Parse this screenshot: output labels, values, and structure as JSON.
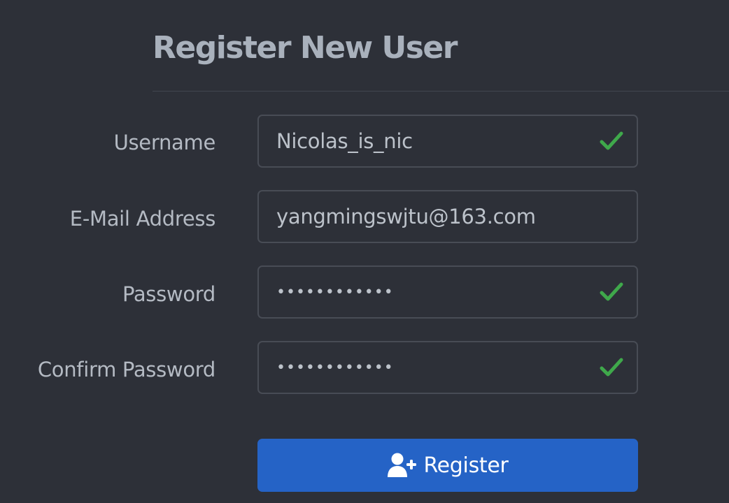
{
  "page": {
    "title": "Register New User"
  },
  "form": {
    "username": {
      "label": "Username",
      "value": "Nicolas_is_nic",
      "valid": true
    },
    "email": {
      "label": "E-Mail Address",
      "value": "yangmingswjtu@163.com",
      "valid": false
    },
    "password": {
      "label": "Password",
      "value": "passwordxxxx",
      "valid": true
    },
    "confirm_password": {
      "label": "Confirm Password",
      "value": "passwordxxxx",
      "valid": true
    },
    "submit": {
      "label": "Register",
      "icon": "user-plus-icon"
    }
  },
  "colors": {
    "background": "#2d3038",
    "accent": "#2563c6",
    "valid": "#3fa84b",
    "input_border": "#484c55"
  }
}
